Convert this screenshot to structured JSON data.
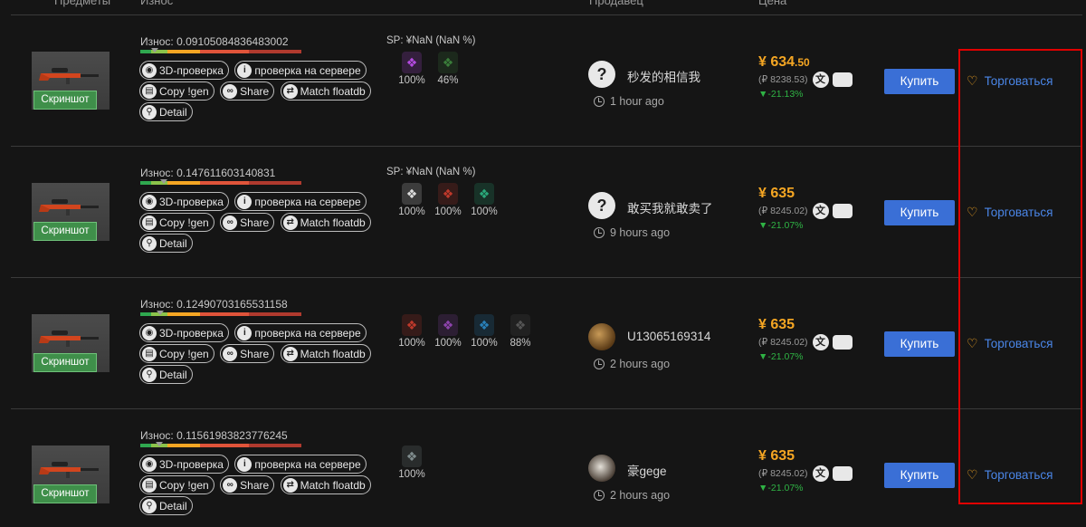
{
  "header": {
    "col_items": "Предметы",
    "col_wear": "Износ",
    "col_seller": "Продавец",
    "col_price": "Цена"
  },
  "rows": [
    {
      "screenshot_label": "Скриншот",
      "wear_text": "Износ: 0.09105084836483002",
      "wear_level": 0.091,
      "sp_text": "SP: ¥NaN (NaN %)",
      "buttons": {
        "check3d": "3D-проверка",
        "server_check": "проверка на сервере",
        "copy_gen": "Copy !gen",
        "share": "Share",
        "match": "Match floatdb",
        "detail": "Detail"
      },
      "stickers": [
        {
          "icon": "sticker-icon",
          "color": "#b44be0",
          "pct": "100%"
        },
        {
          "icon": "sticker-icon",
          "color": "#3a7d3a",
          "pct": "46%"
        }
      ],
      "seller": {
        "avatar": "?",
        "name": "秒发的相信我",
        "time": "1 hour ago",
        "avatar_style": "placeholder"
      },
      "price": {
        "main": "¥ 634",
        "fraction": ".50",
        "rub": "(₽ 8238.53)",
        "change": "▼-21.13%"
      },
      "buy_label": "Купить",
      "trade_label": "Торговаться"
    },
    {
      "screenshot_label": "Скриншот",
      "wear_text": "Износ: 0.147611603140831",
      "wear_level": 0.148,
      "sp_text": "SP: ¥NaN (NaN %)",
      "buttons": {
        "check3d": "3D-проверка",
        "server_check": "проверка на сервере",
        "copy_gen": "Copy !gen",
        "share": "Share",
        "match": "Match floatdb",
        "detail": "Detail"
      },
      "stickers": [
        {
          "icon": "sticker-icon",
          "color": "#dddddd",
          "pct": "100%"
        },
        {
          "icon": "sticker-icon",
          "color": "#c0392b",
          "pct": "100%"
        },
        {
          "icon": "sticker-icon",
          "color": "#2aa87a",
          "pct": "100%"
        }
      ],
      "seller": {
        "avatar": "?",
        "name": "敢买我就敢卖了",
        "time": "9 hours ago",
        "avatar_style": "placeholder"
      },
      "price": {
        "main": "¥ 635",
        "fraction": "",
        "rub": "(₽ 8245.02)",
        "change": "▼-21.07%"
      },
      "buy_label": "Купить",
      "trade_label": "Торговаться"
    },
    {
      "screenshot_label": "Скриншот",
      "wear_text": "Износ: 0.12490703165531158",
      "wear_level": 0.125,
      "sp_text": "",
      "buttons": {
        "check3d": "3D-проверка",
        "server_check": "проверка на сервере",
        "copy_gen": "Copy !gen",
        "share": "Share",
        "match": "Match floatdb",
        "detail": "Detail"
      },
      "stickers": [
        {
          "icon": "sticker-icon",
          "color": "#c0392b",
          "pct": "100%"
        },
        {
          "icon": "sticker-icon",
          "color": "#8e44ad",
          "pct": "100%"
        },
        {
          "icon": "sticker-icon",
          "color": "#2980b9",
          "pct": "100%"
        },
        {
          "icon": "sticker-icon",
          "color": "#555555",
          "pct": "88%"
        }
      ],
      "seller": {
        "avatar": "",
        "name": "U13065169314",
        "time": "2 hours ago",
        "avatar_style": "photo"
      },
      "price": {
        "main": "¥ 635",
        "fraction": "",
        "rub": "(₽ 8245.02)",
        "change": "▼-21.07%"
      },
      "buy_label": "Купить",
      "trade_label": "Торговаться"
    },
    {
      "screenshot_label": "Скриншот",
      "wear_text": "Износ: 0.11561983823776245",
      "wear_level": 0.116,
      "sp_text": "",
      "buttons": {
        "check3d": "3D-проверка",
        "server_check": "проверка на сервере",
        "copy_gen": "Copy !gen",
        "share": "Share",
        "match": "Match floatdb",
        "detail": "Detail"
      },
      "stickers": [
        {
          "icon": "sticker-icon",
          "color": "#7f8c8d",
          "pct": "100%"
        }
      ],
      "seller": {
        "avatar": "",
        "name": "豪gege",
        "time": "2 hours ago",
        "avatar_style": "photo2"
      },
      "price": {
        "main": "¥ 635",
        "fraction": "",
        "rub": "(₽ 8245.02)",
        "change": "▼-21.07%"
      },
      "buy_label": "Купить",
      "trade_label": "Торговаться"
    }
  ]
}
